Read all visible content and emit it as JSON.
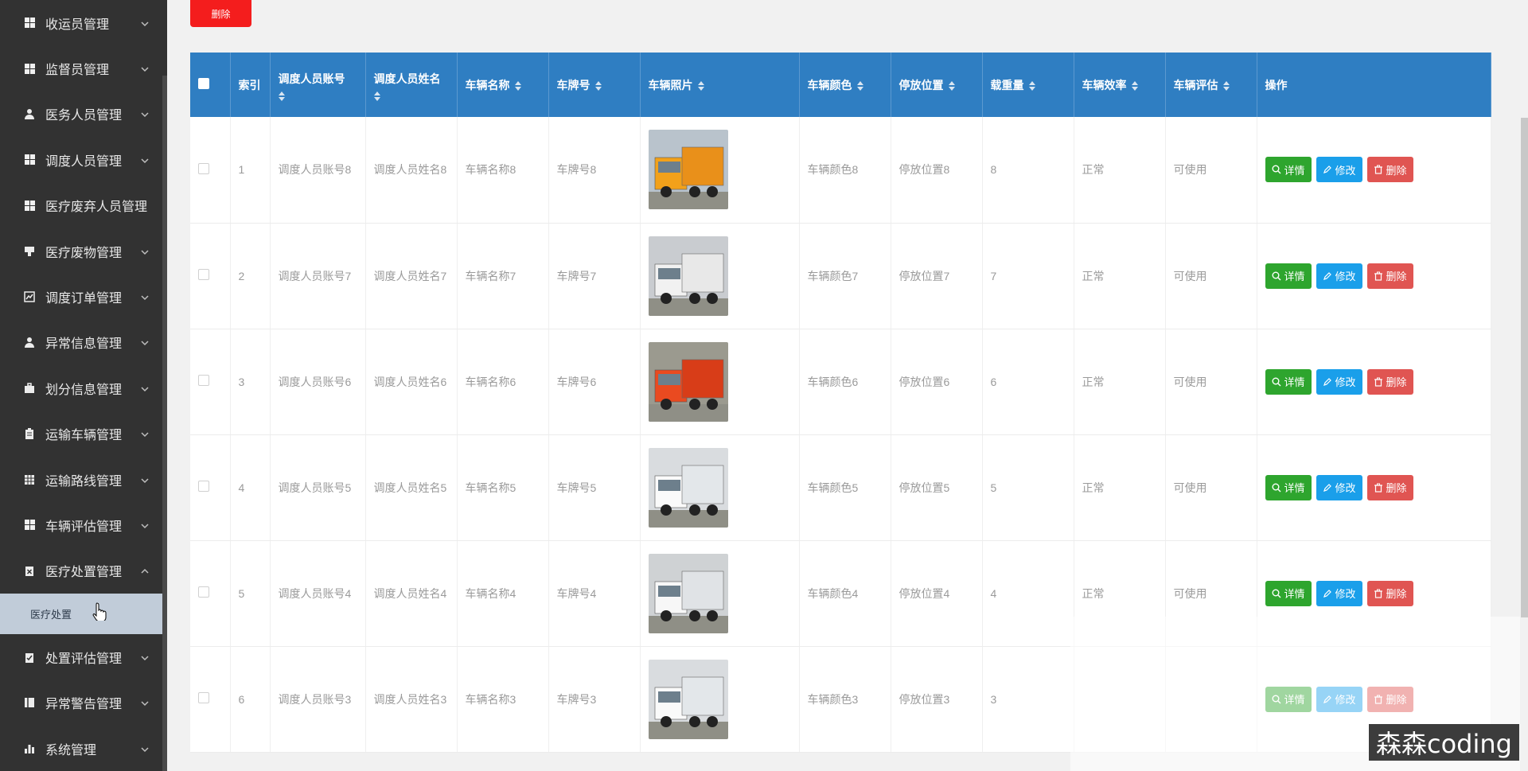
{
  "sidebar": {
    "items": [
      {
        "label": "收运员管理",
        "icon": "grid-icon"
      },
      {
        "label": "监督员管理",
        "icon": "grid-icon"
      },
      {
        "label": "医务人员管理",
        "icon": "user-icon"
      },
      {
        "label": "调度人员管理",
        "icon": "grid-icon"
      },
      {
        "label": "医疗废弃人员管理",
        "icon": "grid-icon"
      },
      {
        "label": "医疗废物管理",
        "icon": "trash-pin-icon"
      },
      {
        "label": "调度订单管理",
        "icon": "chart-icon"
      },
      {
        "label": "异常信息管理",
        "icon": "user-icon"
      },
      {
        "label": "划分信息管理",
        "icon": "briefcase-icon"
      },
      {
        "label": "运输车辆管理",
        "icon": "clipboard-icon"
      },
      {
        "label": "运输路线管理",
        "icon": "table-icon"
      },
      {
        "label": "车辆评估管理",
        "icon": "grid-icon"
      },
      {
        "label": "医疗处置管理",
        "icon": "clipboard-x-icon"
      }
    ],
    "submenu_label": "医疗处置",
    "items_after": [
      {
        "label": "处置评估管理",
        "icon": "clipboard-check-icon"
      },
      {
        "label": "异常警告管理",
        "icon": "book-icon"
      },
      {
        "label": "系统管理",
        "icon": "bar-chart-icon"
      }
    ]
  },
  "toolbar": {
    "delete_label": "删除"
  },
  "table": {
    "headers": {
      "index": "索引",
      "account": "调度人员账号",
      "name": "调度人员姓名",
      "car_name": "车辆名称",
      "plate": "车牌号",
      "photo": "车辆照片",
      "color": "车辆颜色",
      "location": "停放位置",
      "load": "载重量",
      "efficiency": "车辆效率",
      "evaluation": "车辆评估",
      "actions": "操作"
    },
    "rows": [
      {
        "index": "1",
        "account": "调度人员账号8",
        "name": "调度人员姓名8",
        "car_name": "车辆名称8",
        "plate": "车牌号8",
        "color": "车辆颜色8",
        "location": "停放位置8",
        "load": "8",
        "efficiency": "正常",
        "evaluation": "可使用",
        "photo": "yellow-dump-truck"
      },
      {
        "index": "2",
        "account": "调度人员账号7",
        "name": "调度人员姓名7",
        "car_name": "车辆名称7",
        "plate": "车牌号7",
        "color": "车辆颜色7",
        "location": "停放位置7",
        "load": "7",
        "efficiency": "正常",
        "evaluation": "可使用",
        "photo": "white-van-truck"
      },
      {
        "index": "3",
        "account": "调度人员账号6",
        "name": "调度人员姓名6",
        "car_name": "车辆名称6",
        "plate": "车牌号6",
        "color": "车辆颜色6",
        "location": "停放位置6",
        "load": "6",
        "efficiency": "正常",
        "evaluation": "可使用",
        "photo": "red-dump-truck"
      },
      {
        "index": "4",
        "account": "调度人员账号5",
        "name": "调度人员姓名5",
        "car_name": "车辆名称5",
        "plate": "车牌号5",
        "color": "车辆颜色5",
        "location": "停放位置5",
        "load": "5",
        "efficiency": "正常",
        "evaluation": "可使用",
        "photo": "white-box-truck"
      },
      {
        "index": "5",
        "account": "调度人员账号4",
        "name": "调度人员姓名4",
        "car_name": "车辆名称4",
        "plate": "车牌号4",
        "color": "车辆颜色4",
        "location": "停放位置4",
        "load": "4",
        "efficiency": "正常",
        "evaluation": "可使用",
        "photo": "white-box-truck-row"
      },
      {
        "index": "6",
        "account": "调度人员账号3",
        "name": "调度人员姓名3",
        "car_name": "车辆名称3",
        "plate": "车牌号3",
        "color": "车辆颜色3",
        "location": "停放位置3",
        "load": "3",
        "efficiency": "",
        "evaluation": "",
        "photo": "white-box-truck"
      }
    ],
    "actions": {
      "detail": "详情",
      "edit": "修改",
      "delete": "删除"
    }
  },
  "watermark": "森森coding",
  "colors": {
    "sidebar_bg": "#323232",
    "header_bg": "#2f7ec2",
    "delete_red": "#f41d1d",
    "detail_green": "#2ea52e",
    "edit_blue": "#1a9fea",
    "op_delete_red": "#e05552",
    "submenu_bg": "#c1ccd9"
  }
}
